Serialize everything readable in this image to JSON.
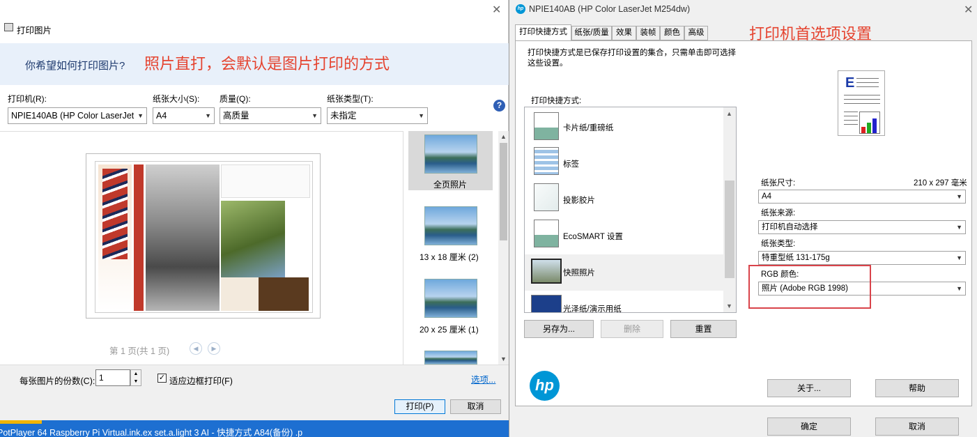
{
  "left": {
    "title": "打印图片",
    "question": "你希望如何打印图片?",
    "annotation": "照片直打，会默认是图片打印的方式",
    "printer_label": "打印机(R):",
    "printer_value": "NPIE140AB (HP Color LaserJet",
    "paper_size_label": "纸张大小(S):",
    "paper_size_value": "A4",
    "quality_label": "质量(Q):",
    "quality_value": "高质量",
    "paper_type_label": "纸张类型(T):",
    "paper_type_value": "未指定",
    "page_indicator": "第 1 页(共 1 页)",
    "layouts": [
      "全页照片",
      "13 x 18 厘米 (2)",
      "20 x 25 厘米 (1)"
    ],
    "copies_label": "每张图片的份数(C):",
    "copies_value": "1",
    "fit_label": "适应边框打印(F)",
    "options_link": "选项...",
    "print_button": "打印(P)",
    "cancel_button": "取消"
  },
  "taskbar": {
    "text": "PotPlayer 64   Raspberry Pi   Virtual.ink.ex    set.a.light 3    AI - 快捷方式  A84(备份)  .p"
  },
  "right": {
    "title": "NPIE140AB (HP Color LaserJet M254dw)",
    "tabs": [
      "打印快捷方式",
      "纸张/质量",
      "效果",
      "装帧",
      "颜色",
      "高级"
    ],
    "annotation": "打印机首选项设置",
    "description": "打印快捷方式是已保存打印设置的集合，只需单击即可选择这些设置。",
    "shortcuts_label": "打印快捷方式:",
    "shortcuts": [
      "卡片纸/重磅纸",
      "标签",
      "投影胶片",
      "EcoSMART 设置",
      "快照照片",
      "光泽纸/演示用纸"
    ],
    "save_as": "另存为...",
    "delete": "删除",
    "reset": "重置",
    "paper_size_label": "纸张尺寸:",
    "paper_size_dim": "210 x 297 毫米",
    "paper_size_value": "A4",
    "paper_source_label": "纸张来源:",
    "paper_source_value": "打印机自动选择",
    "paper_type_label": "纸张类型:",
    "paper_type_value": "特重型纸 131-175g",
    "rgb_label": "RGB 颜色:",
    "rgb_value": "照片 (Adobe RGB 1998)",
    "about": "关于...",
    "help": "帮助",
    "ok": "确定",
    "cancel": "取消",
    "logo_text": "hp"
  },
  "colors": {
    "accent_red": "#e5432f",
    "highlight": "#d9434a",
    "blue_link": "#0066cc"
  }
}
